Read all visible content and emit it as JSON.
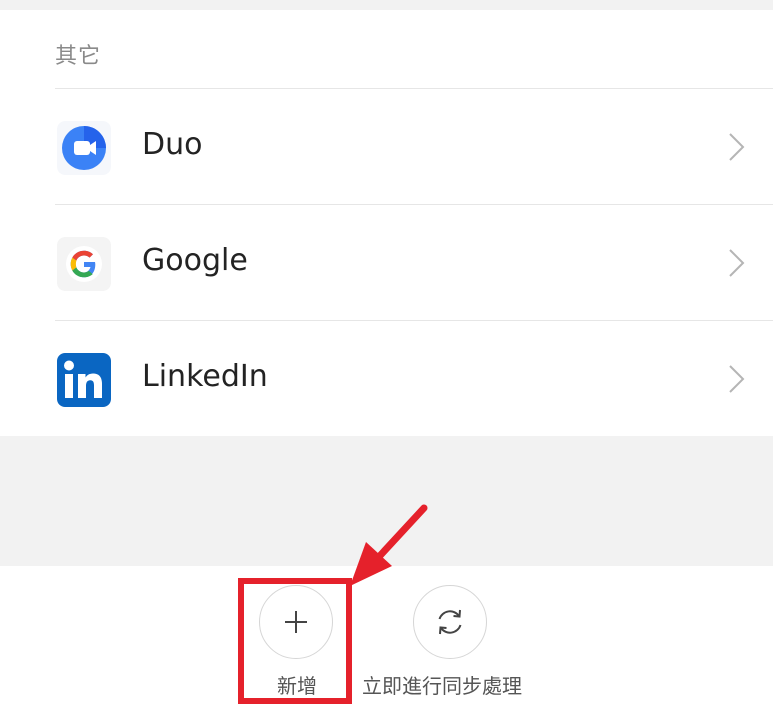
{
  "section": {
    "label": "其它"
  },
  "accounts": [
    {
      "name": "Duo",
      "icon": "duo-icon"
    },
    {
      "name": "Google",
      "icon": "google-icon"
    },
    {
      "name": "LinkedIn",
      "icon": "linkedin-icon"
    }
  ],
  "actions": {
    "add_label": "新增",
    "sync_label": "立即進行同步處理"
  },
  "colors": {
    "highlight": "#e5212b",
    "duo_blue": "#3b82f6",
    "linkedin_blue": "#0a66c2"
  }
}
